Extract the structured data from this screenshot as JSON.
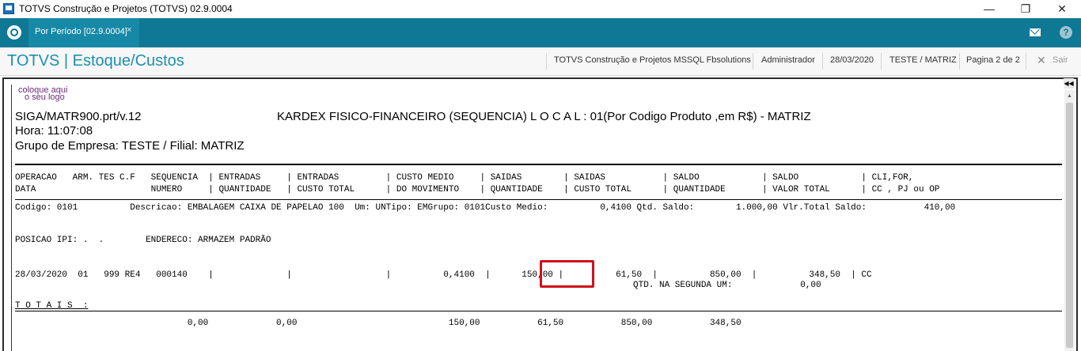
{
  "window": {
    "title": "TOTVS Construção e Projetos (TOTVS) 02.9.0004",
    "minimize_glyph": "—",
    "restore_glyph": "❐",
    "close_glyph": "✕"
  },
  "tabbar": {
    "tab_label": "Por Período [02.9.0004]",
    "tab_close": "×",
    "help_glyph": "?"
  },
  "header": {
    "brand": "TOTVS | Estoque/Custos",
    "company": "TOTVS Construção e Projetos MSSQL Fbsolutions",
    "user": "Administrador",
    "date": "28/03/2020",
    "branch": "TESTE / MATRIZ",
    "page": "Pagina 2 de 2",
    "exit_glyph": "✕",
    "exit_label": "Sair"
  },
  "report": {
    "logo_line1": "coloque aqui",
    "logo_line2": "o seu logo",
    "program": "SIGA/MATR900.prt/v.12",
    "report_title": "KARDEX FISICO-FINANCEIRO (SEQUENCIA) L O C A L : 01(Por  Codigo Produto  ,em R$) - MATRIZ",
    "time": "Hora: 11:07:08",
    "company_group": "Grupo de Empresa: TESTE / Filial: MATRIZ",
    "columns_line1": "OPERACAO   ARM. TES C.F   SEQUENCIA  | ENTRADAS     | ENTRADAS         | CUSTO MEDIO     | SAIDAS        | SAIDAS           | SALDO            | SALDO            | CLI,FOR,",
    "columns_line2": "DATA                      NUMERO     | QUANTIDADE   | CUSTO TOTAL      | DO MOVIMENTO    | QUANTIDADE    | CUSTO TOTAL      | QUANTIDADE       | VALOR TOTAL      | CC , PJ ou OP",
    "product_line": "Codigo: 0101          Descricao: EMBALAGEM CAIXA DE PAPELAO 100  Um: UNTipo: EMGrupo: 0101Custo Medio:          0,4100 Qtd. Saldo:        1.000,00 Vlr.Total Saldo:           410,00",
    "ipi_line": "POSICAO IPI: .  .        ENDERECO: ARMAZEM PADRÃO",
    "movement_line": "28/03/2020  01   999 RE4   000140    |              |                  |          0,4100  |      150,00 |          61,50  |          850,00  |          348,50  | CC",
    "second_unit_line": "QTD. NA SEGUNDA UM:             0,00",
    "totals_label": "T O T A I S  :",
    "totals_line": "                                 0,00             0,00                             150,00           61,50           850,00           348,50"
  }
}
